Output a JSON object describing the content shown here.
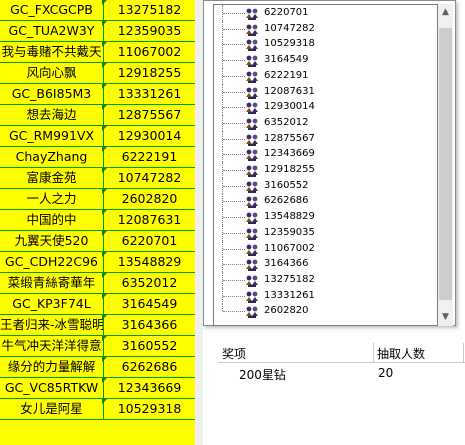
{
  "grid": {
    "rows": [
      {
        "name": "GC_FXCGCPB",
        "id": "13275182"
      },
      {
        "name": "GC_TUA2W3Y",
        "id": "12359035"
      },
      {
        "name": "我与毒赌不共戴天",
        "id": "11067002"
      },
      {
        "name": "风向心飘",
        "id": "12918255"
      },
      {
        "name": "GC_B6I85M3",
        "id": "13331261"
      },
      {
        "name": "想去海边",
        "id": "12875567"
      },
      {
        "name": "GC_RM991VX",
        "id": "12930014"
      },
      {
        "name": "ChayZhang",
        "id": "6222191"
      },
      {
        "name": "富康金苑",
        "id": "10747282"
      },
      {
        "name": "一人之力",
        "id": "2602820"
      },
      {
        "name": "中国的中",
        "id": "12087631"
      },
      {
        "name": "九翼天使520",
        "id": "6220701"
      },
      {
        "name": "GC_CDH22C96",
        "id": "13548829"
      },
      {
        "name": "菜缎青絲寄華年",
        "id": "6352012"
      },
      {
        "name": "GC_KP3F74L",
        "id": "3164549"
      },
      {
        "name": "王者归来-冰雪聪明",
        "id": "3164366"
      },
      {
        "name": "牛气冲天洋洋得意",
        "id": "3160552"
      },
      {
        "name": "缘分的力量解解",
        "id": "6262686"
      },
      {
        "name": "GC_VC85RTKW",
        "id": "12343669"
      },
      {
        "name": "女儿是阿星",
        "id": "10529318"
      }
    ]
  },
  "tree": {
    "items": [
      "6220701",
      "10747282",
      "10529318",
      "3164549",
      "6222191",
      "12087631",
      "12930014",
      "6352012",
      "12875567",
      "12343669",
      "12918255",
      "3160552",
      "6262686",
      "13548829",
      "12359035",
      "11067002",
      "3164366",
      "13275182",
      "13331261",
      "2602820"
    ]
  },
  "panel": {
    "col_prize": "奖项",
    "col_count": "抽取人数",
    "row_prize": "200星钻",
    "row_count": "20"
  },
  "scrollbar": {
    "up": "▲",
    "down": "▼"
  }
}
